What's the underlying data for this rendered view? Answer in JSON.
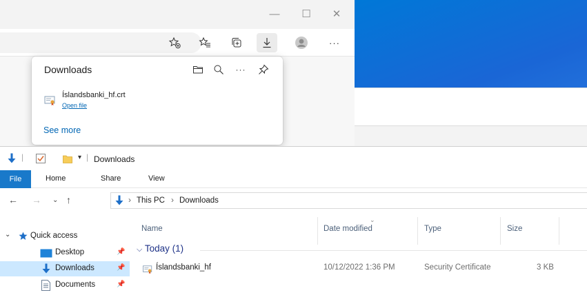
{
  "browser": {
    "window_controls": {
      "minimize": "—",
      "maximize": "☐",
      "close": "✕"
    },
    "toolbar_icons": [
      "add-favorite-icon",
      "favorites-icon",
      "collections-icon",
      "downloads-icon",
      "profile-icon",
      "more-icon"
    ],
    "more_label": "···",
    "downloads_flyout": {
      "title": "Downloads",
      "more_label": "···",
      "item": {
        "file_name": "Íslandsbanki_hf.crt",
        "action": "Open file"
      },
      "see_more": "See more"
    }
  },
  "explorer": {
    "window_title": "Downloads",
    "qat_separator": "|",
    "ribbon_tabs": {
      "file": "File",
      "home": "Home",
      "share": "Share",
      "view": "View"
    },
    "breadcrumb": {
      "root": "This PC",
      "folder": "Downloads",
      "separator": "›"
    },
    "nav_pane": {
      "quick_access": "Quick access",
      "items": [
        {
          "label": "Desktop"
        },
        {
          "label": "Downloads"
        },
        {
          "label": "Documents"
        }
      ]
    },
    "columns": {
      "name": "Name",
      "date": "Date modified",
      "type": "Type",
      "size": "Size"
    },
    "group": {
      "label": "Today (1)"
    },
    "file_row": {
      "name": "Íslandsbanki_hf",
      "date": "10/12/2022 1:36 PM",
      "type": "Security Certificate",
      "size": "3 KB"
    }
  },
  "colors": {
    "accent": "#0078d7",
    "link": "#0066b4",
    "ribbon_file": "#1979ca",
    "selection": "#cce8ff",
    "wallpaper": "#0078d7"
  }
}
